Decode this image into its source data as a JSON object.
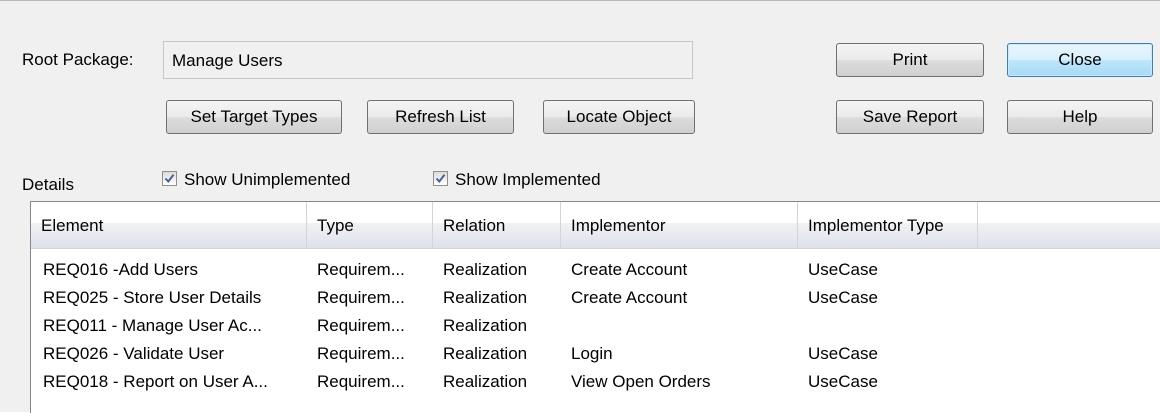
{
  "root_package": {
    "label": "Root Package:",
    "value": "Manage Users"
  },
  "buttons": {
    "print": "Print",
    "close": "Close",
    "set_target_types": "Set Target Types",
    "refresh_list": "Refresh List",
    "locate_object": "Locate Object",
    "save_report": "Save Report",
    "help": "Help"
  },
  "details_label": "Details",
  "checkboxes": {
    "show_unimplemented": {
      "label": "Show Unimplemented",
      "checked": true
    },
    "show_implemented": {
      "label": "Show Implemented",
      "checked": true
    }
  },
  "table": {
    "columns": [
      "Element",
      "Type",
      "Relation",
      "Implementor",
      "Implementor Type"
    ],
    "rows": [
      [
        "REQ016 -Add Users",
        "Requirem...",
        "Realization",
        "Create Account",
        "UseCase"
      ],
      [
        "REQ025 - Store User Details",
        "Requirem...",
        "Realization",
        "Create Account",
        "UseCase"
      ],
      [
        "REQ011 - Manage User Ac...",
        "Requirem...",
        "Realization",
        "",
        ""
      ],
      [
        "REQ026 - Validate User",
        "Requirem...",
        "Realization",
        "Login",
        "UseCase"
      ],
      [
        "REQ018 - Report on User A...",
        "Requirem...",
        "Realization",
        "View Open Orders",
        "UseCase"
      ]
    ]
  },
  "colors": {
    "default_button_border": "#3c7fb1",
    "checkmark": "#4a5f97"
  }
}
